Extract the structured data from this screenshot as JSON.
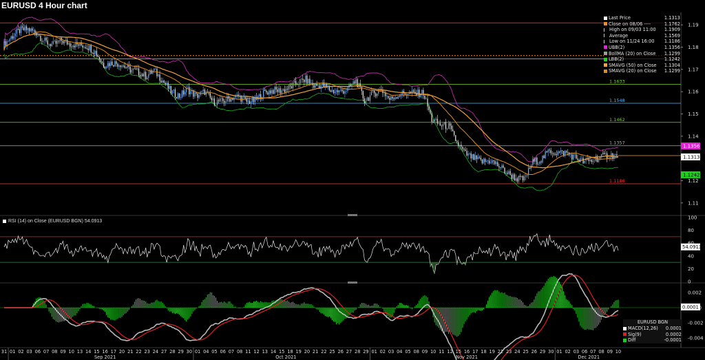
{
  "title": "EURUSD 4 Hour chart",
  "legend": [
    {
      "label": "Last Price",
      "value": "1.1313",
      "color": "#ffffff"
    },
    {
      "label": "Close on 08/06 ----",
      "value": "1.1762",
      "color": "#f28c28"
    },
    {
      "label": "High on 09/03 11:00",
      "value": "1.1909",
      "color": "#000000",
      "marker": "H"
    },
    {
      "label": "Average",
      "value": "1.1569",
      "color": "#000000",
      "marker": "+"
    },
    {
      "label": "Low on 11/24 16:00",
      "value": "1.1186",
      "color": "#000000",
      "marker": "L"
    },
    {
      "label": "UBB(2)",
      "value": "1.1356",
      "color": "#e81ed8"
    },
    {
      "label": "BollMA (20)  on Close",
      "value": "1.1299",
      "color": "#9e9e9e"
    },
    {
      "label": "LBB(2)",
      "value": "1.1242",
      "color": "#19d419"
    },
    {
      "label": "SMAVG (50)  on Close",
      "value": "1.1304",
      "color": "#f2a23a"
    },
    {
      "label": "SMAVG (20)  on Close",
      "value": "1.1299",
      "color": "#e08a1a"
    }
  ],
  "price_axis": {
    "ticks": [
      "1.19",
      "1.18",
      "1.17",
      "1.16",
      "1.15",
      "1.14",
      "1.13",
      "1.12",
      "1.11"
    ]
  },
  "level_labels": [
    {
      "text": "1.1633",
      "color": "#7fd12a"
    },
    {
      "text": "1.1548",
      "color": "#4fb8ff"
    },
    {
      "text": "1.1462",
      "color": "#7fd12a"
    },
    {
      "text": "1.1357",
      "color": "#aaaaaa"
    },
    {
      "text": "1.1186",
      "color": "#ff2a2a"
    }
  ],
  "right_badges": [
    {
      "text": "1.1356",
      "color": "#e81ed8"
    },
    {
      "text": "1.1313",
      "color": "#ffffff"
    },
    {
      "text": "1.1242",
      "color": "#19d419"
    }
  ],
  "rsi": {
    "label": "RSI (14)  on Close (EURUSD BGN)  54.0913",
    "badge": "54.0913",
    "ticks": [
      "100",
      "80",
      "60",
      "40",
      "20",
      "0"
    ]
  },
  "macd": {
    "ticks": [
      "0.002",
      "0.000",
      "-0.002",
      "-0.004"
    ],
    "badge": "0.0001",
    "legend_title": "EURUSD BGN",
    "legend": [
      {
        "label": "MACD(12,26)",
        "value": "0.0001",
        "color": "#ffffff"
      },
      {
        "label": "Sig(9)",
        "value": "0.0002",
        "color": "#e02020"
      },
      {
        "label": "Diff",
        "value": "-0.0001",
        "color": "#19d419"
      }
    ]
  },
  "x_axis": {
    "days": [
      "31",
      "01",
      "02",
      "03",
      "06",
      "07",
      "08",
      "09",
      "10",
      "13",
      "14",
      "15",
      "16",
      "17",
      "20",
      "21",
      "22",
      "23",
      "24",
      "27",
      "28",
      "29",
      "30",
      "01",
      "04",
      "05",
      "06",
      "07",
      "08",
      "11",
      "12",
      "13",
      "14",
      "15",
      "18",
      "19",
      "20",
      "21",
      "22",
      "25",
      "26",
      "27",
      "28",
      "29",
      "01",
      "02",
      "03",
      "04",
      "05",
      "08",
      "09",
      "10",
      "11",
      "12",
      "15",
      "16",
      "17",
      "18",
      "19",
      "22",
      "23",
      "24",
      "25",
      "26",
      "29",
      "30",
      "01",
      "02",
      "03",
      "06",
      "07",
      "08",
      "09",
      "10"
    ],
    "months": [
      "Sep 2021",
      "Oct 2021",
      "Nov 2021",
      "Dec 2021"
    ]
  },
  "chart_data": {
    "type": "line",
    "title": "EURUSD 4 Hour chart",
    "x_range": [
      "2021-08-31",
      "2021-12-10"
    ],
    "ylim": [
      1.105,
      1.195
    ],
    "price_close_daily": [
      1.1805,
      1.1845,
      1.1875,
      1.188,
      1.1865,
      1.1825,
      1.181,
      1.183,
      1.1815,
      1.181,
      1.1805,
      1.178,
      1.172,
      1.173,
      1.1725,
      1.17,
      1.169,
      1.167,
      1.1695,
      1.165,
      1.16,
      1.158,
      1.161,
      1.158,
      1.16,
      1.1555,
      1.1555,
      1.157,
      1.158,
      1.1555,
      1.156,
      1.1595,
      1.1605,
      1.1605,
      1.1615,
      1.164,
      1.1655,
      1.1625,
      1.163,
      1.1605,
      1.16,
      1.161,
      1.165,
      1.156,
      1.159,
      1.161,
      1.1565,
      1.1585,
      1.1595,
      1.159,
      1.1595,
      1.1475,
      1.145,
      1.1445,
      1.137,
      1.132,
      1.13,
      1.1285,
      1.129,
      1.1265,
      1.1235,
      1.121,
      1.1205,
      1.1285,
      1.1295,
      1.1335,
      1.1325,
      1.1325,
      1.1305,
      1.1285,
      1.129,
      1.1305,
      1.1315,
      1.1313
    ],
    "levels": {
      "high": 1.1909,
      "close_0806": 1.1762,
      "average": 1.1569,
      "low": 1.1186,
      "ubb": 1.1356,
      "boll_ma": 1.1299,
      "lbb": 1.1242,
      "sma50": 1.1304,
      "sma20": 1.1299,
      "fib": [
        1.1633,
        1.1548,
        1.1462,
        1.1357
      ]
    },
    "rsi": {
      "ylim": [
        0,
        100
      ],
      "overbought": 70,
      "oversold": 30,
      "last": 54.0913
    },
    "macd": {
      "ylim": [
        -0.005,
        0.003
      ],
      "macd": 0.0001,
      "signal": 0.0002,
      "diff": -0.0001
    }
  }
}
